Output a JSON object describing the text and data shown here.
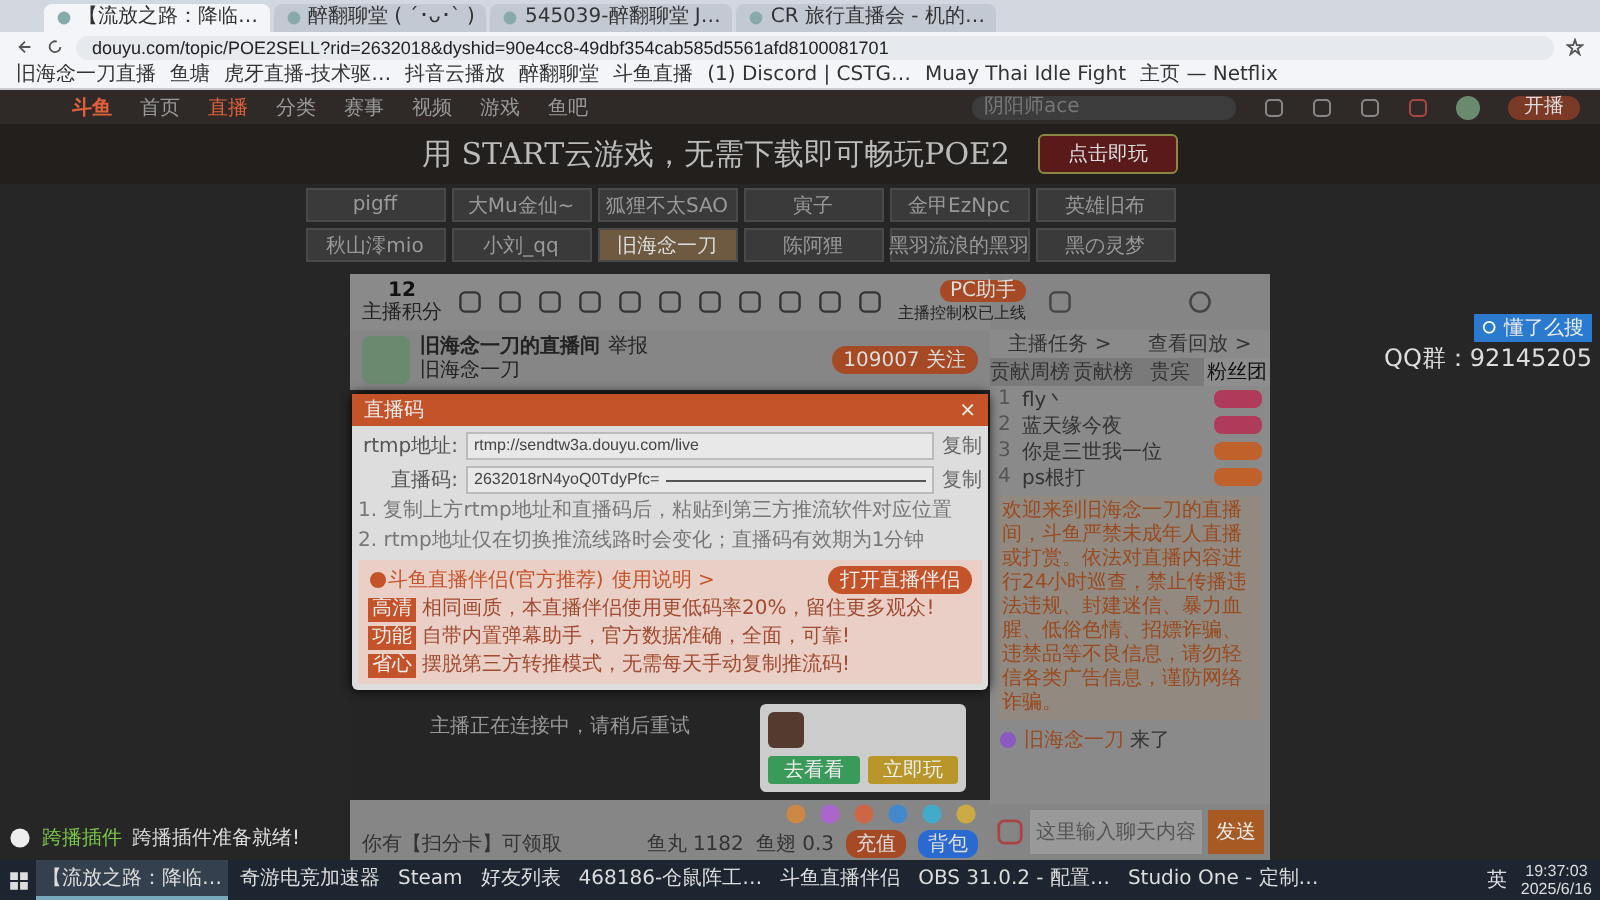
{
  "browser": {
    "tabs": [
      {
        "label": "【流放之路：降临…",
        "selected": true
      },
      {
        "label": "醉翻聊堂 ( ´･ᴗ･` )",
        "selected": false
      },
      {
        "label": "545039-醉翻聊堂 J…",
        "selected": false
      },
      {
        "label": "CR 旅行直播会 - 机的…",
        "selected": false
      }
    ],
    "url": "douyu.com/topic/POE2SELL?rid=2632018&dyshid=90e4cc8-49dbf354cab585d5561afd8100081701",
    "bookmarks": [
      "旧海念一刀直播",
      "鱼塘",
      "虎牙直播-技术驱…",
      "抖音云播放",
      "醉翻聊堂",
      "斗鱼直播",
      "(1) Discord | CSTG…",
      "Muay Thai Idle Fight",
      "主页 — Netflix"
    ]
  },
  "site_nav": {
    "logo": "斗鱼",
    "items": [
      {
        "label": "首页",
        "selected": false
      },
      {
        "label": "直播",
        "selected": true
      },
      {
        "label": "分类",
        "selected": false
      },
      {
        "label": "赛事",
        "selected": false
      },
      {
        "label": "视频",
        "selected": false
      },
      {
        "label": "游戏",
        "selected": false
      },
      {
        "label": "鱼吧",
        "selected": false
      }
    ],
    "search_placeholder": "阴阳师ace",
    "start_button": "开播"
  },
  "banner": {
    "text": "用 START云游戏，无需下载即可畅玩POE2",
    "button": "点击即玩"
  },
  "streamers": [
    {
      "name": "pigff",
      "selected": false
    },
    {
      "name": "大Mu金仙~",
      "selected": false
    },
    {
      "name": "狐狸不太SAO",
      "selected": false
    },
    {
      "name": "寅子",
      "selected": false
    },
    {
      "name": "金甲EzNpc",
      "selected": false
    },
    {
      "name": "英雄旧布",
      "selected": false
    },
    {
      "name": "秋山澪mio",
      "selected": false
    },
    {
      "name": "小刘_qq",
      "selected": false
    },
    {
      "name": "旧海念一刀",
      "selected": true
    },
    {
      "name": "陈阿狸",
      "selected": false
    },
    {
      "name": "黑羽流浪的黑羽",
      "selected": false
    },
    {
      "name": "黑の灵梦",
      "selected": false
    }
  ],
  "room": {
    "points": "12",
    "points_label": "主播积分",
    "title": "旧海念一刀的直播间",
    "report": "举报",
    "anchor": "旧海念一刀",
    "follow_count": "109007",
    "follow": "关注",
    "pc_button": "PC助手",
    "pc_note": "主播控制权已上线",
    "status": "主播正在连接中，请稍后重试",
    "notice": "你有【扫分卡】可领取",
    "fishball": "鱼丸 1182",
    "fishfin": "鱼翅 0.3",
    "recharge": "充值",
    "backpack": "背包"
  },
  "dialog": {
    "title": "直播码",
    "close": "×",
    "fields": [
      {
        "label": "rtmp地址:",
        "value": "rtmp://sendtw3a.douyu.com/live",
        "copy": "复制",
        "masked": false
      },
      {
        "label": "直播码:",
        "value": "2632018rN4yoQ0TdyPfc=",
        "copy": "复制",
        "masked": true
      }
    ],
    "notes": [
      "1. 复制上方rtmp地址和直播码后，粘贴到第三方推流软件对应位置",
      "2. rtmp地址仅在切换推流线路时会变化；直播码有效期为1分钟"
    ],
    "promo": {
      "title": "斗鱼直播伴侣(官方推荐)",
      "link": "使用说明 >",
      "button": "打开直播伴侣",
      "lines": [
        {
          "tag": "高清",
          "text": "相同画质，本直播伴侣使用更低码率20%，留住更多观众!"
        },
        {
          "tag": "功能",
          "text": "自带内置弹幕助手，官方数据准确，全面，可靠!"
        },
        {
          "tag": "省心",
          "text": "摆脱第三方转推模式，无需每天手动复制推流码!"
        }
      ]
    }
  },
  "ad_card": {
    "buttons": [
      "去看看",
      "立即玩"
    ]
  },
  "chat": {
    "links": [
      "主播任务 >",
      "查看回放 >"
    ],
    "tabs": [
      {
        "label": "贡献周榜",
        "selected": false
      },
      {
        "label": "贡献榜",
        "selected": false
      },
      {
        "label": "贵宾",
        "selected": false
      },
      {
        "label": "粉丝团",
        "selected": true
      }
    ],
    "rank": [
      {
        "number": "1",
        "name": "fly丶"
      },
      {
        "number": "2",
        "name": "蓝天缘今夜"
      },
      {
        "number": "3",
        "name": "你是三世我一位"
      },
      {
        "number": "4",
        "name": "ps根打"
      }
    ],
    "message": "欢迎来到旧海念一刀的直播间，斗鱼严禁未成年人直播或打赏。依法对直播内容进行24小时巡查，禁止传播违法违规、封建迷信、暴力血腥、低俗色情、招嫖诈骗、违禁品等不良信息，请勿轻信各类广告信息，谨防网络诈骗。",
    "join_user": "旧海念一刀",
    "join_text": "来了",
    "placeholder": "这里输入聊天内容",
    "send": "发送"
  },
  "side": {
    "qq": "QQ群：92145205",
    "search_hint": "懂了么搜"
  },
  "plugin": {
    "name": "跨播插件",
    "status": "跨播插件准备就绪!"
  },
  "taskbar": {
    "items": [
      {
        "label": "【流放之路：降临…",
        "selected": true
      },
      {
        "label": "奇游电竞加速器",
        "selected": false
      },
      {
        "label": "Steam",
        "selected": false
      },
      {
        "label": "好友列表",
        "selected": false
      },
      {
        "label": "468186-仓鼠阵工…",
        "selected": false
      },
      {
        "label": "斗鱼直播伴侣",
        "selected": false
      },
      {
        "label": "OBS 31.0.2 - 配置…",
        "selected": false
      },
      {
        "label": "Studio One - 定制…",
        "selected": false
      }
    ],
    "lang": "英",
    "time": "19:37:03",
    "date": "2025/6/16"
  }
}
